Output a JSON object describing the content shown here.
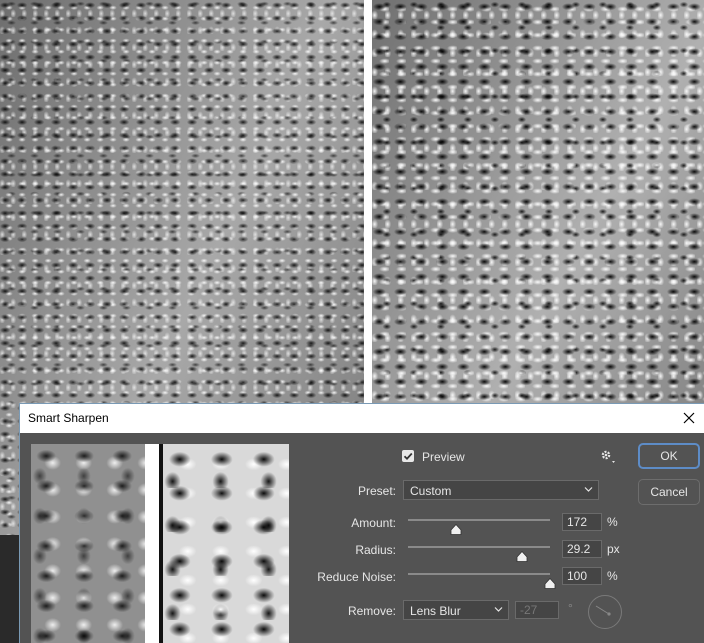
{
  "dialog": {
    "title": "Smart Sharpen",
    "preview_label": "Preview",
    "preview_checked": true,
    "preset": {
      "label": "Preset:",
      "value": "Custom"
    },
    "amount": {
      "label": "Amount:",
      "value": "172",
      "unit": "%",
      "fraction": 0.34
    },
    "radius": {
      "label": "Radius:",
      "value": "29.2",
      "unit": "px",
      "fraction": 0.8
    },
    "reduce_noise": {
      "label": "Reduce Noise:",
      "value": "100",
      "unit": "%",
      "fraction": 1.0
    },
    "remove": {
      "label": "Remove:",
      "value": "Lens Blur",
      "angle_value": "-27",
      "angle_unit": "°"
    },
    "buttons": {
      "ok": "OK",
      "cancel": "Cancel"
    }
  },
  "colors": {
    "dialog_bg": "#535353",
    "accent": "#5d8cc7"
  }
}
